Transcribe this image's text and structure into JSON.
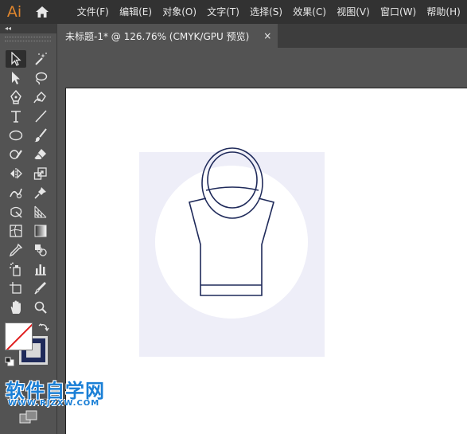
{
  "app": {
    "logo": "Ai",
    "accent": "#e0862d"
  },
  "menu": [
    "文件(F)",
    "编辑(E)",
    "对象(O)",
    "文字(T)",
    "选择(S)",
    "效果(C)",
    "视图(V)",
    "窗口(W)",
    "帮助(H)"
  ],
  "tabs": [
    {
      "title": "未标题-1* @ 126.76% (CMYK/GPU 预览)",
      "close": "×"
    }
  ],
  "tools_panel": {
    "collapse": "◂◂",
    "tools": [
      "selection-tool",
      "magic-wand-tool",
      "direct-selection-tool",
      "lasso-tool",
      "pen-tool",
      "curvature-tool",
      "type-tool",
      "line-segment-tool",
      "ellipse-tool",
      "paintbrush-tool",
      "shaper-tool",
      "eraser-tool",
      "reflect-tool",
      "scale-tool",
      "warp-tool",
      "puppet-warp-tool",
      "free-transform-tool",
      "perspective-grid-tool",
      "mesh-tool",
      "gradient-tool",
      "eyedropper-tool",
      "blend-tool",
      "symbol-sprayer-tool",
      "column-graph-tool",
      "artboard-tool",
      "slice-tool",
      "hand-tool",
      "zoom-tool"
    ],
    "fill_color": "#ffffff",
    "stroke_color": "#1f2a5a"
  },
  "artwork": {
    "background_square_color": "#eeeef8",
    "circle_color": "#ffffff",
    "stroke_color": "#1f2a5a"
  },
  "watermark": {
    "text": "软件自学网",
    "url": "WWW.RJZXW.COM"
  }
}
